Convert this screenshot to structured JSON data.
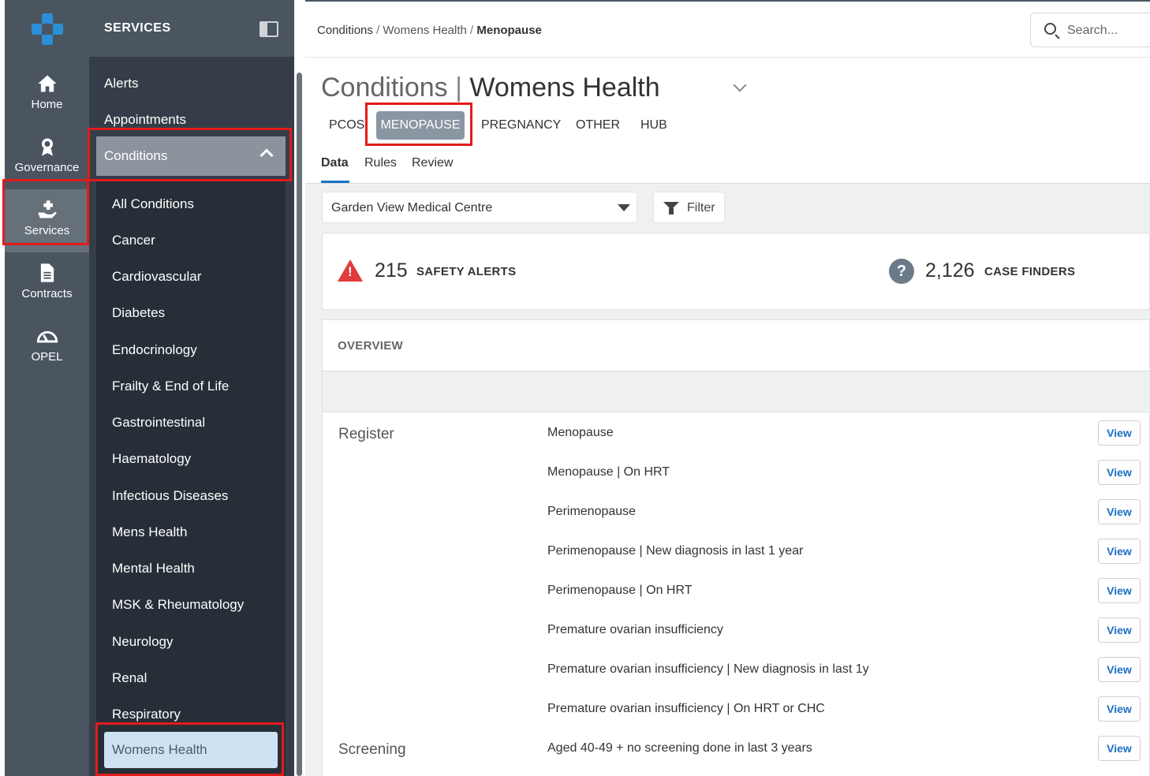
{
  "rail": {
    "items": [
      {
        "label": "Home",
        "icon": "home-icon"
      },
      {
        "label": "Governance",
        "icon": "award-icon"
      },
      {
        "label": "Services",
        "icon": "hand-plus-icon",
        "active": true
      },
      {
        "label": "Contracts",
        "icon": "document-icon"
      },
      {
        "label": "OPEL",
        "icon": "gauge-icon"
      }
    ]
  },
  "panel": {
    "title": "SERVICES",
    "top_items": [
      "Alerts",
      "Appointments"
    ],
    "section": "Conditions",
    "sub_items": [
      "All Conditions",
      "Cancer",
      "Cardiovascular",
      "Diabetes",
      "Endocrinology",
      "Frailty & End of Life",
      "Gastrointestinal",
      "Haematology",
      "Infectious Diseases",
      "Mens Health",
      "Mental Health",
      "MSK & Rheumatology",
      "Neurology",
      "Renal",
      "Respiratory"
    ],
    "active_item": "Womens Health"
  },
  "breadcrumb": {
    "items": [
      "Conditions",
      "Womens Health"
    ],
    "current": "Menopause",
    "sep": "/"
  },
  "search": {
    "placeholder": "Search..."
  },
  "title": {
    "prefix": "Conditions",
    "sep": "|",
    "main": "Womens Health"
  },
  "tabs": [
    "PCOS",
    "MENOPAUSE",
    "PREGNANCY",
    "OTHER",
    "HUB"
  ],
  "active_tab": "MENOPAUSE",
  "subtabs": [
    "Data",
    "Rules",
    "Review"
  ],
  "practice_select": {
    "value": "Garden View Medical Centre"
  },
  "filter_label": "Filter",
  "safety_alerts": {
    "count": "215",
    "label": "SAFETY ALERTS"
  },
  "case_finders": {
    "count": "2,126",
    "label": "CASE FINDERS"
  },
  "overview": {
    "title": "OVERVIEW",
    "groups": [
      {
        "name": "Register",
        "rows": [
          "Menopause",
          "Menopause | On HRT",
          "Perimenopause",
          "Perimenopause | New diagnosis in last 1 year",
          "Perimenopause | On HRT",
          "Premature ovarian insufficiency",
          "Premature ovarian insufficiency | New diagnosis in last 1y",
          "Premature ovarian insufficiency | On HRT or CHC"
        ]
      },
      {
        "name": "Screening",
        "rows": [
          "Aged 40-49 + no screening done in last 3 years"
        ]
      }
    ],
    "view_label": "View"
  },
  "colors": {
    "accent": "#1a73c8",
    "highlight": "#e21b1b",
    "rail": "#4a5560",
    "panel": "#353e48"
  }
}
